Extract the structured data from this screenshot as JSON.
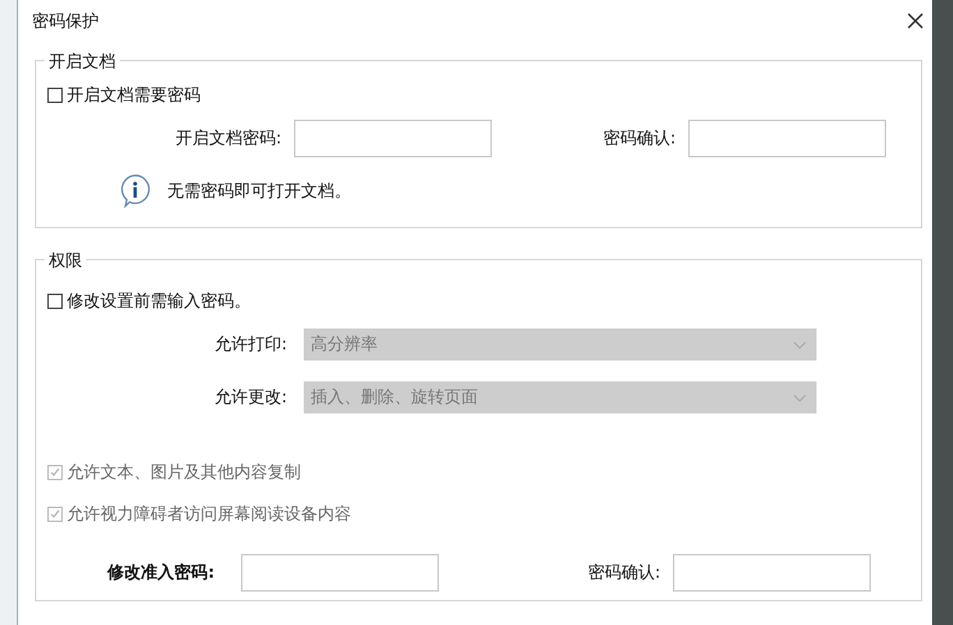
{
  "window": {
    "title": "密码保护"
  },
  "open_section": {
    "legend": "开启文档",
    "require_password": {
      "label": "开启文档需要密码",
      "checked": false,
      "disabled": false
    },
    "password_label": "开启文档密码:",
    "confirm_label": "密码确认:",
    "info": "无需密码即可打开文档。"
  },
  "permissions": {
    "legend": "权限",
    "require_password": {
      "label": "修改设置前需输入密码。",
      "checked": false,
      "disabled": false
    },
    "dropdowns": [
      {
        "label": "允许打印:",
        "value": "高分辨率",
        "disabled": true
      },
      {
        "label": "允许更改:",
        "value": "插入、删除、旋转页面",
        "disabled": true
      }
    ],
    "options": [
      {
        "label": "允许文本、图片及其他内容复制",
        "checked": true,
        "disabled": true
      },
      {
        "label": "允许视力障碍者访问屏幕阅读设备内容",
        "checked": true,
        "disabled": true
      }
    ],
    "password_label": "修改准入密码:",
    "confirm_label": "密码确认:"
  }
}
